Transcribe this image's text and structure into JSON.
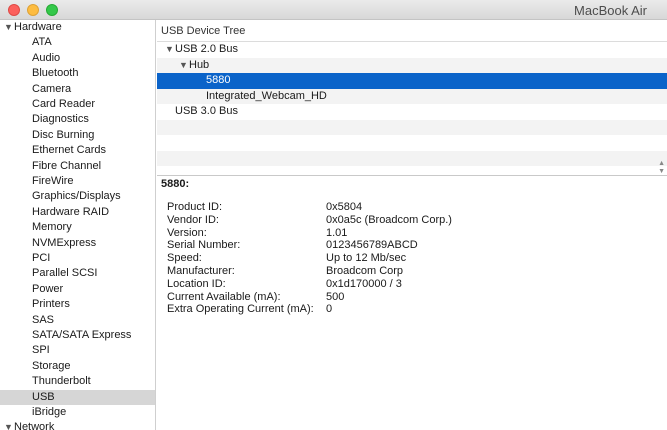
{
  "window": {
    "title": "MacBook Air"
  },
  "sidebar": {
    "categories": [
      {
        "label": "Hardware",
        "expanded": true
      },
      {
        "label": "Network",
        "expanded": true
      }
    ],
    "items": [
      "ATA",
      "Audio",
      "Bluetooth",
      "Camera",
      "Card Reader",
      "Diagnostics",
      "Disc Burning",
      "Ethernet Cards",
      "Fibre Channel",
      "FireWire",
      "Graphics/Displays",
      "Hardware RAID",
      "Memory",
      "NVMExpress",
      "PCI",
      "Parallel SCSI",
      "Power",
      "Printers",
      "SAS",
      "SATA/SATA Express",
      "SPI",
      "Storage",
      "Thunderbolt",
      "USB",
      "iBridge"
    ],
    "selected": "USB"
  },
  "tree": {
    "header": "USB Device Tree",
    "rows": [
      {
        "label": "USB 2.0 Bus",
        "expanded": true
      },
      {
        "label": "Hub",
        "expanded": true
      },
      {
        "label": "5880",
        "selected": true
      },
      {
        "label": "Integrated_Webcam_HD"
      },
      {
        "label": "USB 3.0 Bus"
      }
    ]
  },
  "details": {
    "title": "5880:",
    "fields": [
      {
        "key": "Product ID:",
        "value": "0x5804"
      },
      {
        "key": "Vendor ID:",
        "value": "0x0a5c  (Broadcom Corp.)"
      },
      {
        "key": "Version:",
        "value": "1.01"
      },
      {
        "key": "Serial Number:",
        "value": "0123456789ABCD"
      },
      {
        "key": "Speed:",
        "value": "Up to 12 Mb/sec"
      },
      {
        "key": "Manufacturer:",
        "value": "Broadcom Corp"
      },
      {
        "key": "Location ID:",
        "value": "0x1d170000 / 3"
      },
      {
        "key": "Current Available (mA):",
        "value": "500"
      },
      {
        "key": "Extra Operating Current (mA):",
        "value": "0"
      }
    ]
  },
  "colors": {
    "selection": "#0a63c9",
    "sidebar_selection": "#d6d6d6"
  }
}
